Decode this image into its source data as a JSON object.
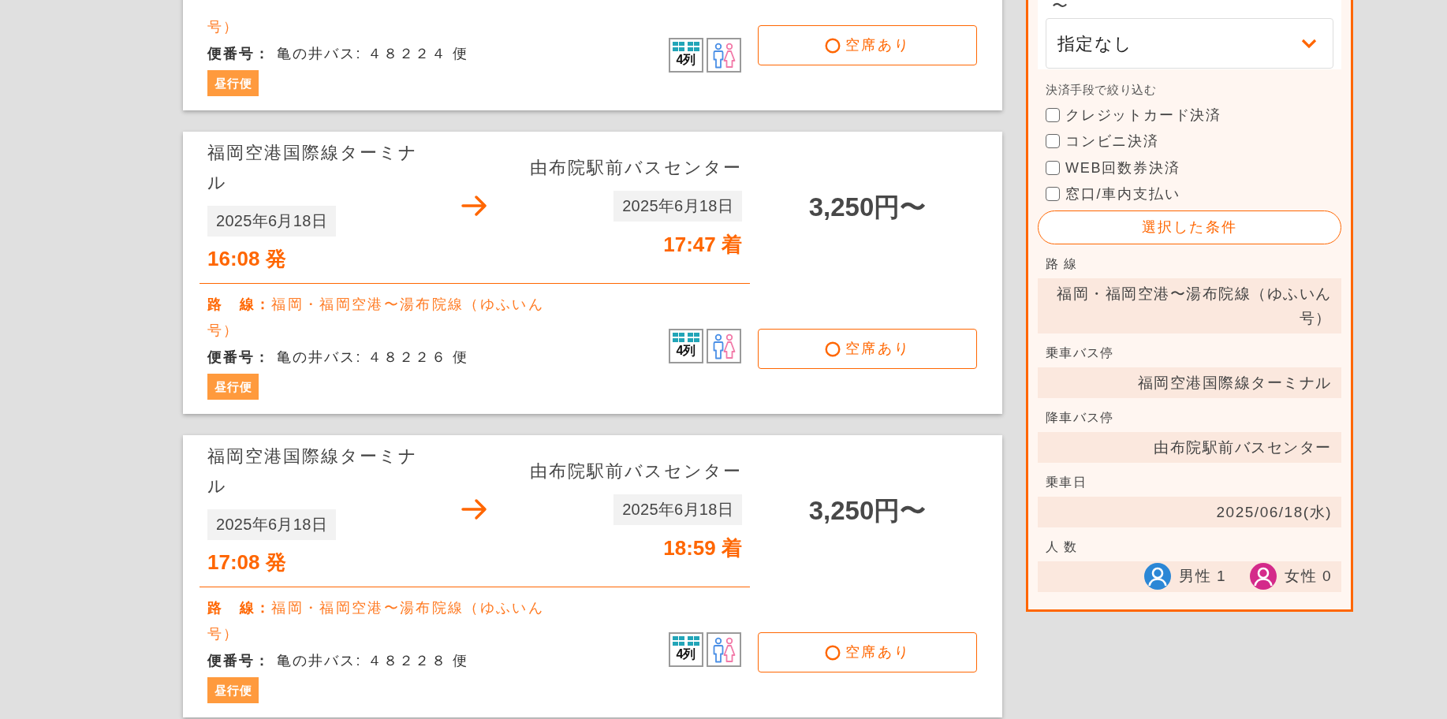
{
  "results": [
    {
      "route": "号）",
      "flight_label": "便番号：",
      "flight": "亀の井バス: ４８２２４ 便",
      "service_tag": "昼行便",
      "seat_layout": "4列",
      "availability": "空席あり"
    },
    {
      "departure": {
        "stop": "福岡空港国際線ターミナル",
        "date": "2025年6月18日",
        "time": "16:08 発"
      },
      "arrival": {
        "stop": "由布院駅前バスセンター",
        "date": "2025年6月18日",
        "time": "17:47 着"
      },
      "price": "3,250円〜",
      "route_label": "路　線：",
      "route": "福岡・福岡空港〜湯布院線（ゆふいん号）",
      "flight_label": "便番号：",
      "flight": "亀の井バス: ４８２２６ 便",
      "service_tag": "昼行便",
      "seat_layout": "4列",
      "availability": "空席あり"
    },
    {
      "departure": {
        "stop": "福岡空港国際線ターミナル",
        "date": "2025年6月18日",
        "time": "17:08 発"
      },
      "arrival": {
        "stop": "由布院駅前バスセンター",
        "date": "2025年6月18日",
        "time": "18:59 着"
      },
      "price": "3,250円〜",
      "route_label": "路　線：",
      "route": "福岡・福岡空港〜湯布院線（ゆふいん号）",
      "flight_label": "便番号：",
      "flight": "亀の井バス: ４８２２８ 便",
      "service_tag": "昼行便",
      "seat_layout": "4列",
      "availability": "空席あり"
    }
  ],
  "filters": {
    "range_separator": "〜",
    "time_select": {
      "value": "指定なし"
    },
    "payment_heading": "決済手段で絞り込む",
    "payment_options": [
      {
        "label": "クレジットカード決済",
        "checked": false
      },
      {
        "label": "コンビニ決済",
        "checked": false
      },
      {
        "label": "WEB回数券決済",
        "checked": false
      },
      {
        "label": "窓口/車内支払い",
        "checked": false
      }
    ],
    "selected_conditions_button": "選択した条件",
    "conditions": [
      {
        "kind": "text",
        "label": "路 線",
        "value": "福岡・福岡空港〜湯布院線（ゆふいん号）"
      },
      {
        "kind": "text",
        "label": "乗車バス停",
        "value": "福岡空港国際線ターミナル"
      },
      {
        "kind": "text",
        "label": "降車バス停",
        "value": "由布院駅前バスセンター"
      },
      {
        "kind": "text",
        "label": "乗車日",
        "value": "2025/06/18(水)"
      },
      {
        "kind": "passengers",
        "label": "人 数",
        "passengers": [
          {
            "label": "男性 1",
            "color": "#2b87d6"
          },
          {
            "label": "女性 0",
            "color": "#d42a8a"
          }
        ]
      }
    ]
  }
}
